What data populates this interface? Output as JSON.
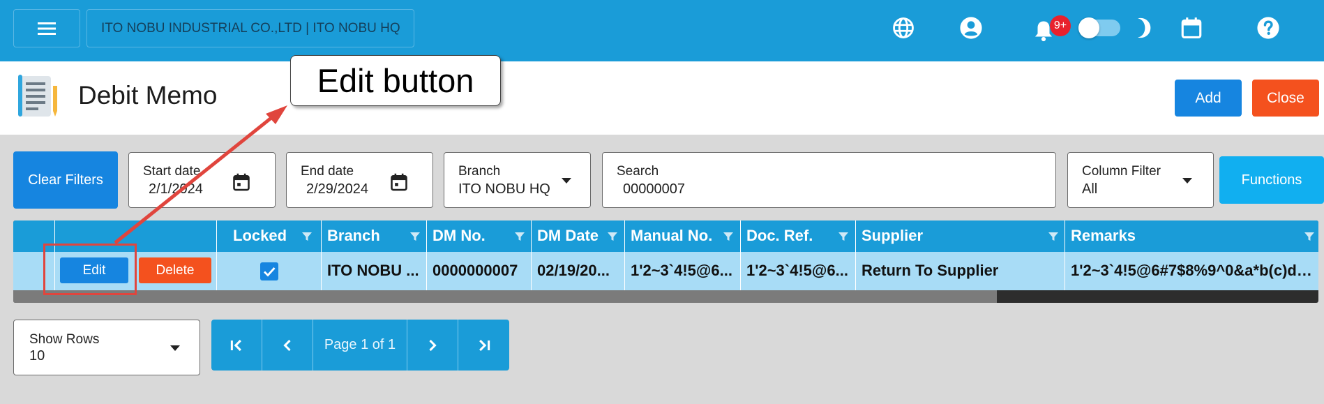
{
  "topbar": {
    "company": "ITO NOBU INDUSTRIAL CO.,LTD | ITO NOBU HQ",
    "notification_badge": "9+",
    "icons": [
      "menu-icon",
      "globe-icon",
      "account-icon",
      "bell-icon",
      "moon-icon",
      "calendar-icon",
      "help-icon"
    ]
  },
  "header": {
    "title": "Debit Memo",
    "add_label": "Add",
    "close_label": "Close"
  },
  "callout": {
    "text": "Edit button"
  },
  "filters": {
    "clear_label": "Clear Filters",
    "start_date": {
      "label": "Start date",
      "value": "2/1/2024"
    },
    "end_date": {
      "label": "End date",
      "value": "2/29/2024"
    },
    "branch": {
      "label": "Branch",
      "value": "ITO NOBU HQ"
    },
    "search": {
      "label": "Search",
      "value": "00000007"
    },
    "column_filter": {
      "label": "Column Filter",
      "value": "All"
    },
    "functions_label": "Functions"
  },
  "table": {
    "headers": {
      "locked": "Locked",
      "branch": "Branch",
      "dm_no": "DM No.",
      "dm_date": "DM Date",
      "manual_no": "Manual No.",
      "doc_ref": "Doc. Ref.",
      "supplier": "Supplier",
      "remarks": "Remarks"
    },
    "rows": [
      {
        "edit_label": "Edit",
        "delete_label": "Delete",
        "locked": true,
        "branch": "ITO NOBU ...",
        "dm_no": "0000000007",
        "dm_date": "02/19/20...",
        "manual_no": "1'2~3`4!5@6...",
        "doc_ref": "1'2~3`4!5@6...",
        "supplier": "Return To Supplier",
        "remarks": "1'2~3`4!5@6#7$8%9^0&a*b(c)d_..."
      }
    ]
  },
  "pagination": {
    "show_rows_label": "Show Rows",
    "show_rows_value": "10",
    "page_label": "Page 1 of 1"
  },
  "colors": {
    "primary_blue": "#1a9cd8",
    "button_blue": "#1685e0",
    "danger_orange": "#f4511e",
    "row_highlight": "#a8dcf6",
    "callout_red": "#e0453d"
  }
}
